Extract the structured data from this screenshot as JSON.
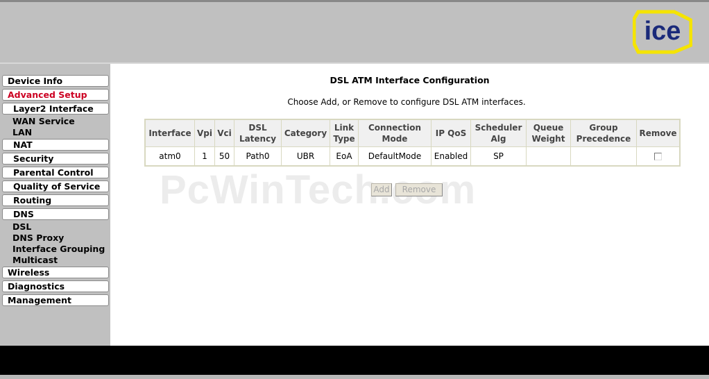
{
  "header": {
    "logo_text": "ice",
    "logo_color": "#1a2a7a",
    "logo_border_color": "#f5e400"
  },
  "sidebar": {
    "items": [
      {
        "label": "Device Info"
      },
      {
        "label": "Advanced Setup"
      },
      {
        "label": "Layer2 Interface"
      },
      {
        "label": "WAN Service"
      },
      {
        "label": "LAN"
      },
      {
        "label": "NAT"
      },
      {
        "label": "Security"
      },
      {
        "label": "Parental Control"
      },
      {
        "label": "Quality of Service"
      },
      {
        "label": "Routing"
      },
      {
        "label": "DNS"
      },
      {
        "label": "DSL"
      },
      {
        "label": "DNS Proxy"
      },
      {
        "label": "Interface Grouping"
      },
      {
        "label": "Multicast"
      },
      {
        "label": "Wireless"
      },
      {
        "label": "Diagnostics"
      },
      {
        "label": "Management"
      }
    ],
    "active_color": "#cc0022"
  },
  "main": {
    "title": "DSL ATM Interface Configuration",
    "description": "Choose Add, or Remove to configure DSL ATM interfaces.",
    "table": {
      "headers": [
        [
          "Interface"
        ],
        [
          "Vpi"
        ],
        [
          "Vci"
        ],
        [
          "DSL",
          "Latency"
        ],
        [
          "Category"
        ],
        [
          "Link",
          "Type"
        ],
        [
          "Connection",
          "Mode"
        ],
        [
          "IP QoS"
        ],
        [
          "Scheduler",
          "Alg"
        ],
        [
          "Queue",
          "Weight"
        ],
        [
          "Group",
          "Precedence"
        ],
        [
          "Remove"
        ]
      ],
      "rows": [
        [
          "atm0",
          "1",
          "50",
          "Path0",
          "UBR",
          "EoA",
          "DefaultMode",
          "Enabled",
          "SP",
          "",
          ""
        ]
      ]
    },
    "add_label": "Add",
    "remove_label": "Remove",
    "watermark": "PcWinTech.com"
  }
}
